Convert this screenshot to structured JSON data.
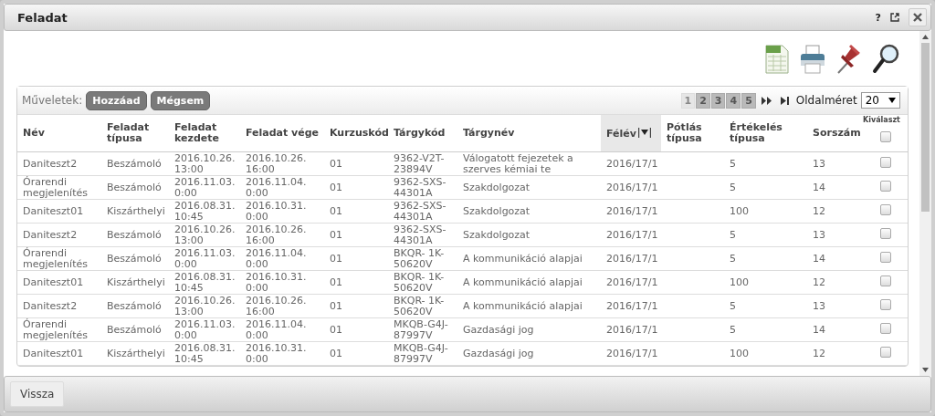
{
  "window": {
    "title": "Feladat",
    "help": "?"
  },
  "toolbar": {
    "label": "Műveletek:",
    "buttons": [
      "Hozzáad",
      "Mégsem"
    ]
  },
  "pager": {
    "pages": [
      {
        "label": "1",
        "selected": true
      },
      {
        "label": "2",
        "selected": false
      },
      {
        "label": "3",
        "selected": false
      },
      {
        "label": "4",
        "selected": false
      },
      {
        "label": "5",
        "selected": false
      }
    ],
    "page_size_label": "Oldalméret",
    "page_size": "20"
  },
  "table": {
    "columns": [
      {
        "label": "Név",
        "sorted": false
      },
      {
        "label": "Feladat típusa",
        "sorted": false
      },
      {
        "label": "Feladat kezdete",
        "sorted": false
      },
      {
        "label": "Feladat vége",
        "sorted": false
      },
      {
        "label": "Kurzuskód",
        "sorted": false
      },
      {
        "label": "Tárgykód",
        "sorted": false
      },
      {
        "label": "Tárgynév",
        "sorted": false
      },
      {
        "label": "Félév",
        "sorted": true
      },
      {
        "label": "Pótlás típusa",
        "sorted": false
      },
      {
        "label": "Értékelés típusa",
        "sorted": false
      },
      {
        "label": "Sorszám",
        "sorted": false
      },
      {
        "label": "Kiválaszt",
        "sorted": false
      }
    ],
    "select_all_checked": false,
    "rows": [
      {
        "cells": [
          "Daniteszt2",
          "Beszámoló",
          "2016.10.26. 13:00",
          "2016.10.26. 16:00",
          "01",
          "9362-V2T-23894V",
          "Válogatott fejezetek a szerves kémiai te",
          "2016/17/1",
          "",
          "5",
          "13"
        ],
        "checked": false
      },
      {
        "cells": [
          "Órarendi megjelenítés",
          "Beszámoló",
          "2016.11.03. 0:00",
          "2016.11.04. 0:00",
          "01",
          "9362-SXS-44301A",
          "Szakdolgozat",
          "2016/17/1",
          "",
          "5",
          "14"
        ],
        "checked": false
      },
      {
        "cells": [
          "Daniteszt01",
          "Kiszárthelyi",
          "2016.08.31. 10:45",
          "2016.10.31. 0:00",
          "01",
          "9362-SXS-44301A",
          "Szakdolgozat",
          "2016/17/1",
          "",
          "100",
          "12"
        ],
        "checked": false
      },
      {
        "cells": [
          "Daniteszt2",
          "Beszámoló",
          "2016.10.26. 13:00",
          "2016.10.26. 16:00",
          "01",
          "9362-SXS-44301A",
          "Szakdolgozat",
          "2016/17/1",
          "",
          "5",
          "13"
        ],
        "checked": false
      },
      {
        "cells": [
          "Órarendi megjelenítés",
          "Beszámoló",
          "2016.11.03. 0:00",
          "2016.11.04. 0:00",
          "01",
          "BKQR- 1K-50620V",
          "A kommunikáció alapjai",
          "2016/17/1",
          "",
          "5",
          "14"
        ],
        "checked": false
      },
      {
        "cells": [
          "Daniteszt01",
          "Kiszárthelyi",
          "2016.08.31. 10:45",
          "2016.10.31. 0:00",
          "01",
          "BKQR- 1K-50620V",
          "A kommunikáció alapjai",
          "2016/17/1",
          "",
          "100",
          "12"
        ],
        "checked": false
      },
      {
        "cells": [
          "Daniteszt2",
          "Beszámoló",
          "2016.10.26. 13:00",
          "2016.10.26. 16:00",
          "01",
          "BKQR- 1K-50620V",
          "A kommunikáció alapjai",
          "2016/17/1",
          "",
          "5",
          "13"
        ],
        "checked": false
      },
      {
        "cells": [
          "Órarendi megjelenítés",
          "Beszámoló",
          "2016.11.03. 0:00",
          "2016.11.04. 0:00",
          "01",
          "MKQB-G4J-87997V",
          "Gazdasági jog",
          "2016/17/1",
          "",
          "5",
          "14"
        ],
        "checked": false
      },
      {
        "cells": [
          "Daniteszt01",
          "Kiszárthelyi",
          "2016.08.31. 10:45",
          "2016.10.31. 0:00",
          "01",
          "MKQB-G4J-87997V",
          "Gazdasági jog",
          "2016/17/1",
          "",
          "100",
          "12"
        ],
        "checked": false
      }
    ]
  },
  "footer": {
    "button": "Vissza"
  }
}
